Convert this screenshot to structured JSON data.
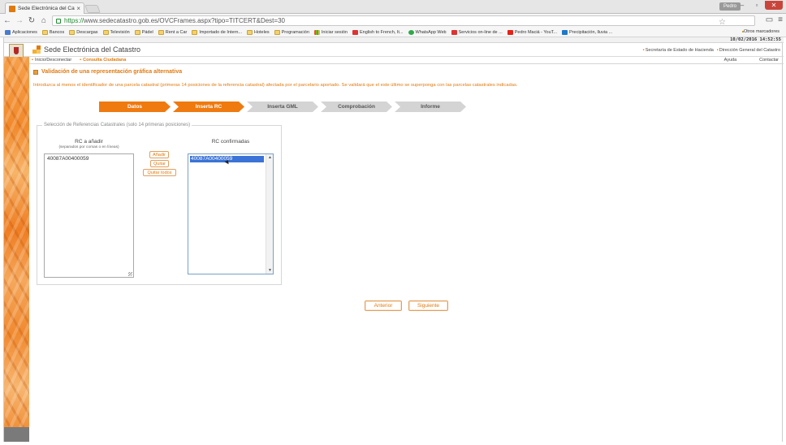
{
  "browser": {
    "tab_title": "Sede Electrónica del Cata",
    "tab_close": "×",
    "user": "Pedro",
    "window_controls": [
      "–",
      "▫",
      "✕"
    ],
    "url_https": "https://",
    "url_rest": "www.sedecatastro.gob.es/OVCFrames.aspx?tipo=TITCERT&Dest=30",
    "nav_icons": [
      "arrow-left-icon",
      "arrow-right-icon",
      "reload-icon",
      "home-icon"
    ],
    "bookmarks": [
      {
        "label": "Aplicaciones",
        "icon": "grid"
      },
      {
        "label": "Bancos",
        "icon": "folder"
      },
      {
        "label": "Descargas",
        "icon": "folder"
      },
      {
        "label": "Televisión",
        "icon": "folder"
      },
      {
        "label": "Pádel",
        "icon": "folder"
      },
      {
        "label": "Rent a Car",
        "icon": "folder"
      },
      {
        "label": "Importado de Intern...",
        "icon": "folder"
      },
      {
        "label": "Hoteles",
        "icon": "folder"
      },
      {
        "label": "Programación",
        "icon": "folder"
      },
      {
        "label": "Iniciar sesión",
        "icon": "ms"
      },
      {
        "label": "English to French, It...",
        "icon": "red"
      },
      {
        "label": "WhatsApp Web",
        "icon": "green"
      },
      {
        "label": "Servicios on-line de ...",
        "icon": "red"
      },
      {
        "label": "Pedro Maciá - YouT...",
        "icon": "yt"
      },
      {
        "label": "Precipitación, lluvia ...",
        "icon": "w"
      }
    ],
    "other_bookmarks": "Otros marcadores"
  },
  "site": {
    "datetime": "10/02/2016 14:52:55",
    "title": "Sede Electrónica del Catastro",
    "gov_links": [
      "Secretaría de Estado de Hacienda",
      "Dirección General del Catastro"
    ],
    "nav_left": [
      "Inicio/Desconectar",
      "Consulta Ciudadana"
    ],
    "nav_right": [
      "Ayuda",
      "Contactar"
    ]
  },
  "page": {
    "title": "Validación de una representación gráfica alternativa",
    "intro": "Introduzca al menos el identificador de una parcela catastral (primeras 14 posiciones de la referencia catastral) afectada por el parcelario aportado. Se validará que el este último se superponga con las parcelas catastrales indicadas.",
    "steps": [
      {
        "label": "Datos",
        "state": "active"
      },
      {
        "label": "Inserta RC",
        "state": "active"
      },
      {
        "label": "Inserta GML",
        "state": "inactive"
      },
      {
        "label": "Comprobación",
        "state": "inactive"
      },
      {
        "label": "Informe",
        "state": "inactive"
      }
    ],
    "fieldset_legend": "Selección de Referencias Catastrales (solo 14 primeras posiciones)",
    "rc_add_title": "RC a añadir",
    "rc_add_hint": "(separados por comas o en líneas)",
    "rc_add_value": "40087A00400059",
    "buttons": {
      "add": "Añadir",
      "remove": "Quitar",
      "remove_all": "Quitar todos"
    },
    "rc_confirmed_title": "RC confirmadas",
    "rc_confirmed_items": [
      "40087A00400059"
    ],
    "prev": "Anterior",
    "next": "Siguiente"
  },
  "colors": {
    "accent": "#ef7a10",
    "step_inactive": "#d4d4d4",
    "selection": "#3b73d6"
  }
}
